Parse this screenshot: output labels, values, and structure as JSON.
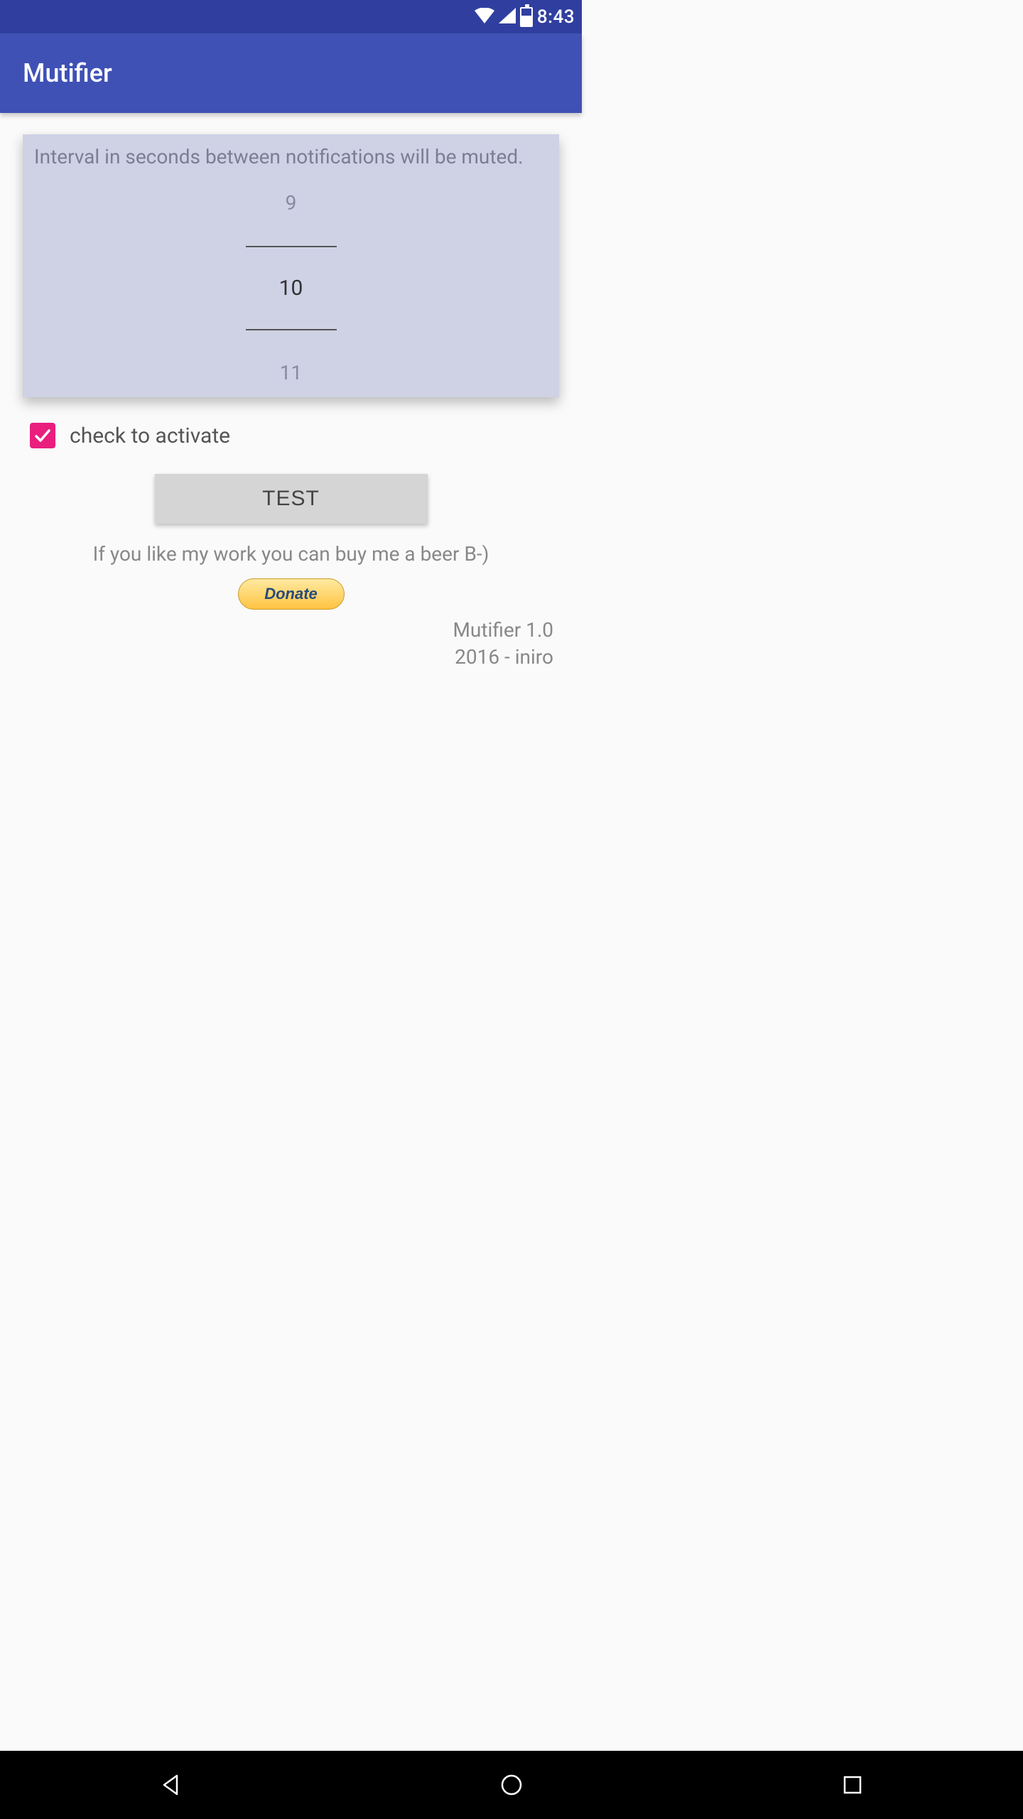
{
  "status": {
    "time": "8:43",
    "battery_level": "42"
  },
  "header": {
    "title": "Mutifier"
  },
  "card": {
    "label": "Interval in seconds between notifications will be muted.",
    "picker_prev": "9",
    "picker_value": "10",
    "picker_next": "11"
  },
  "activate": {
    "checked": true,
    "label": "check to activate"
  },
  "test": {
    "label": "TEST"
  },
  "donate": {
    "prompt": "If you like my work you can buy me a beer B-)",
    "button": "Donate"
  },
  "version": {
    "line1": "Mutifier 1.0",
    "line2": "2016 - iniro"
  }
}
